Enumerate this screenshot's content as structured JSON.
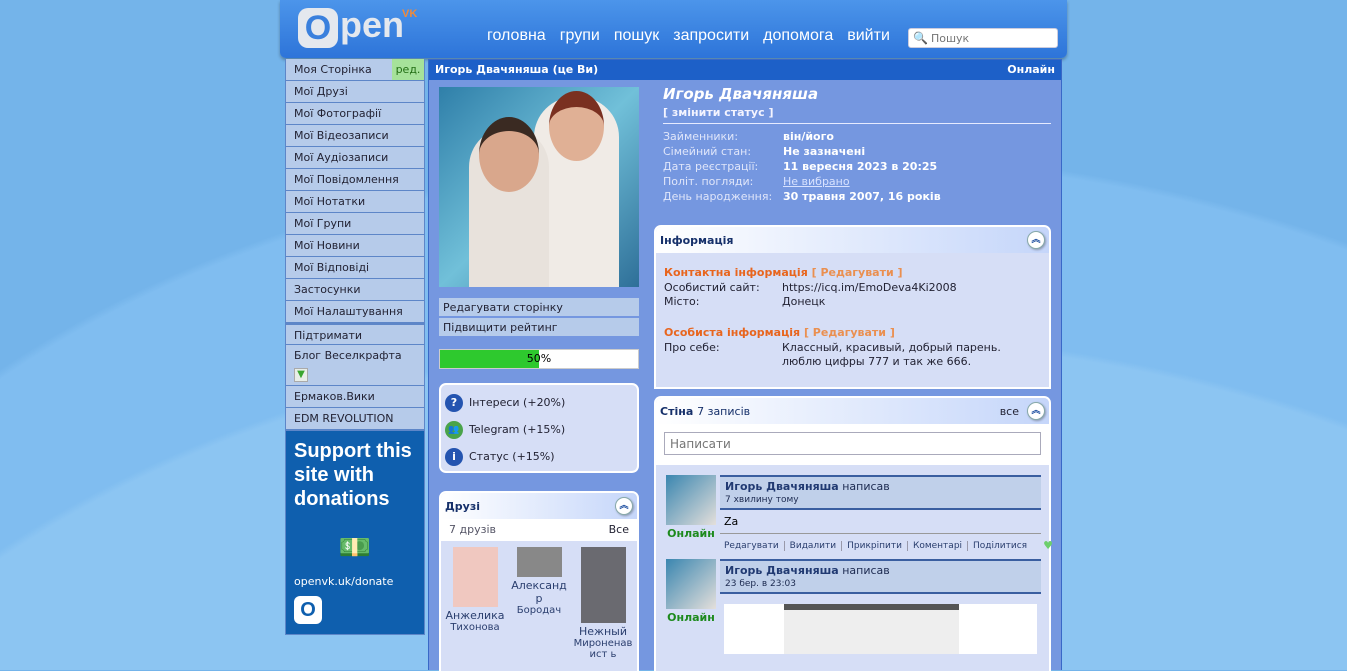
{
  "header": {
    "logo_text": "Open",
    "logo_sup": "VK",
    "nav": [
      "головна",
      "групи",
      "пошук",
      "запросити",
      "допомога",
      "вийти"
    ],
    "search_placeholder": "Пошук"
  },
  "sidebar": {
    "items": [
      "Моя Сторінка",
      "Мої Друзі",
      "Мої Фотографії",
      "Мої Відеозаписи",
      "Мої Аудіозаписи",
      "Мої Повідомлення",
      "Мої Нотатки",
      "Мої Групи",
      "Мої Новини",
      "Мої Відповіді",
      "Застосунки",
      "Мої Налаштування"
    ],
    "edit_label": "ред.",
    "links": [
      "Підтримати",
      "Блог Веселкрафта",
      "Ермаков.Вики",
      "EDM REVOLUTION"
    ],
    "donate": {
      "title": "Support this site with donations",
      "url": "openvk.uk/donate",
      "logo": "O"
    }
  },
  "main": {
    "title": "Игорь Двачяняша (це Ви)",
    "online": "Онлайн"
  },
  "left": {
    "edit_page": "Редагувати сторінку",
    "raise_rating": "Підвищити рейтинг",
    "progress": 50,
    "progress_label": "50%",
    "rating_items": [
      {
        "icon": "question-icon",
        "label": "Інтереси (+20%)"
      },
      {
        "icon": "telegram-icon",
        "label": "Telegram (+15%)"
      },
      {
        "icon": "info-icon",
        "label": "Статус (+15%)"
      }
    ]
  },
  "friends": {
    "title": "Друзі",
    "count": "7 друзів",
    "all": "Все",
    "list": [
      {
        "first": "Анжелика",
        "last": "Тихонова"
      },
      {
        "first": "Александр",
        "last": "Бородач"
      },
      {
        "first": "Нежный",
        "last": "Мироненавист ь"
      }
    ]
  },
  "profile": {
    "name": "Игорь Двачяняша",
    "change_status": "[ змінити статус ]",
    "rows": [
      {
        "k": "Займенники:",
        "v": "він/його"
      },
      {
        "k": "Сімейний стан:",
        "v": "Не зазначені"
      },
      {
        "k": "Дата реєстрації:",
        "v": "11 вересня 2023 в 20:25"
      },
      {
        "k": "Політ. погляди:",
        "v": "Не вибрано"
      },
      {
        "k": "День народження:",
        "v": "30 травня 2007, 16 років"
      }
    ]
  },
  "info": {
    "title": "Інформація",
    "contact_title": "Контактна інформація",
    "edit": "[ Редагувати ]",
    "site_k": "Особистий сайт:",
    "site_v": "https://icq.im/EmoDeva4Ki2008",
    "city_k": "Місто:",
    "city_v": "Донецк",
    "personal_title": "Особиста інформація",
    "about_k": "Про себе:",
    "about_v": "Классный, красивый, добрый парень. люблю цифры 777 и так же 666."
  },
  "wall": {
    "title": "Стіна",
    "count": "7 записів",
    "all": "все",
    "placeholder": "Написати",
    "posts": [
      {
        "author": "Игорь Двачяняша",
        "verb": "написав",
        "time": "7 хвилину тому",
        "text": "Za",
        "online": "Онлайн"
      },
      {
        "author": "Игорь Двачяняша",
        "verb": "написав",
        "time": "23 бер. в 23:03",
        "online": "Онлайн"
      }
    ],
    "actions": [
      "Редагувати",
      "Видалити",
      "Прикріпити",
      "Коментарі",
      "Поділитися"
    ]
  }
}
